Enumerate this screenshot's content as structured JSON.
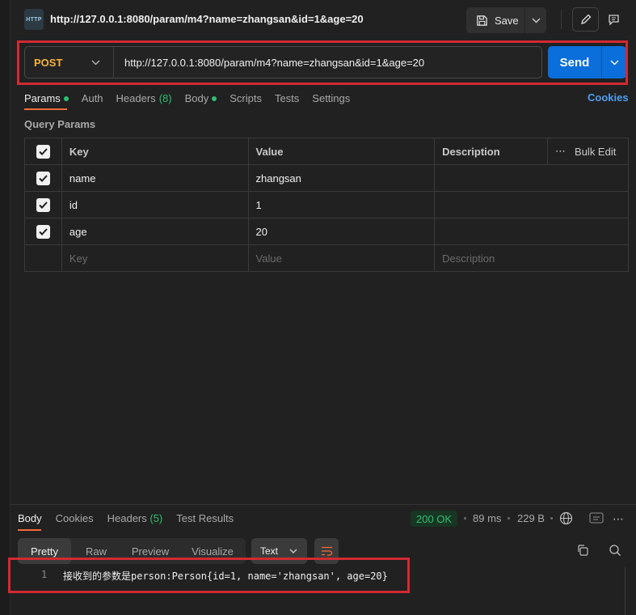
{
  "tab": {
    "title": "http://127.0.0.1:8080/param/m4?name=zhangsan&id=1&age=20",
    "icon_label": "HTTP"
  },
  "toolbar": {
    "save_label": "Save"
  },
  "request": {
    "method": "POST",
    "url": "http://127.0.0.1:8080/param/m4?name=zhangsan&id=1&age=20",
    "send_label": "Send"
  },
  "request_tabs": {
    "params": "Params",
    "auth": "Auth",
    "headers": "Headers",
    "headers_count": "(8)",
    "body": "Body",
    "scripts": "Scripts",
    "tests": "Tests",
    "settings": "Settings",
    "cookies": "Cookies"
  },
  "query_params": {
    "label": "Query Params",
    "columns": {
      "key": "Key",
      "value": "Value",
      "description": "Description",
      "bulk_edit": "Bulk Edit"
    },
    "rows": [
      {
        "key": "name",
        "value": "zhangsan",
        "description": "",
        "checked": true
      },
      {
        "key": "id",
        "value": "1",
        "description": "",
        "checked": true
      },
      {
        "key": "age",
        "value": "20",
        "description": "",
        "checked": true
      }
    ],
    "placeholders": {
      "key": "Key",
      "value": "Value",
      "description": "Description"
    }
  },
  "response": {
    "tabs": {
      "body": "Body",
      "cookies": "Cookies",
      "headers": "Headers",
      "headers_count": "(5)",
      "test_results": "Test Results"
    },
    "status": "200 OK",
    "time": "89 ms",
    "size": "229 B",
    "formats": {
      "pretty": "Pretty",
      "raw": "Raw",
      "preview": "Preview",
      "visualize": "Visualize"
    },
    "language": "Text",
    "line_number": "1",
    "body_text": "接收到的参数是person:Person{id=1, name='zhangsan', age=20}"
  },
  "colors": {
    "accent": "#f26b3a",
    "send": "#0a6edb",
    "method": "#f7b23b",
    "ok": "#2fbf71",
    "highlight": "#d12a33"
  }
}
